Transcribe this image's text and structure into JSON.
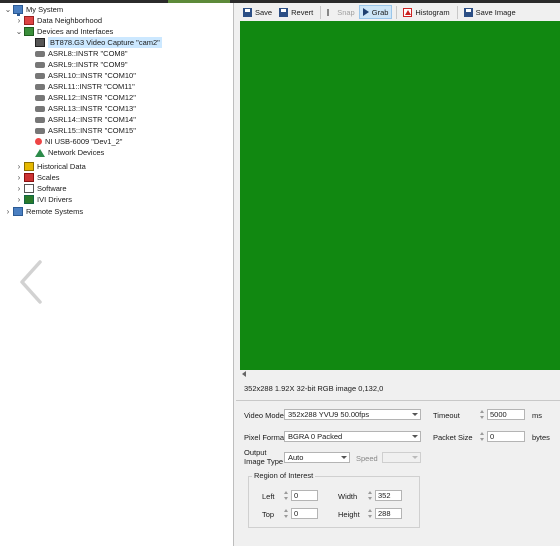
{
  "tree": {
    "items": [
      {
        "label": "My System",
        "icon": "computer-icon",
        "chevron": "v"
      },
      {
        "label": "Data Neighborhood",
        "icon": "data-neighborhood-icon",
        "chevron": ">"
      },
      {
        "label": "Devices and Interfaces",
        "icon": "devices-icon",
        "chevron": "v"
      },
      {
        "label": "BT878.G3 Video Capture  \"cam2\"",
        "icon": "camera-icon",
        "chevron": "",
        "selected": true
      },
      {
        "label": "ASRL8::INSTR \"COM8\"",
        "icon": "serial-port-icon",
        "chevron": ""
      },
      {
        "label": "ASRL9::INSTR \"COM9\"",
        "icon": "serial-port-icon",
        "chevron": ""
      },
      {
        "label": "ASRL10::INSTR \"COM10\"",
        "icon": "serial-port-icon",
        "chevron": ""
      },
      {
        "label": "ASRL11::INSTR \"COM11\"",
        "icon": "serial-port-icon",
        "chevron": ""
      },
      {
        "label": "ASRL12::INSTR \"COM12\"",
        "icon": "serial-port-icon",
        "chevron": ""
      },
      {
        "label": "ASRL13::INSTR \"COM13\"",
        "icon": "serial-port-icon",
        "chevron": ""
      },
      {
        "label": "ASRL14::INSTR \"COM14\"",
        "icon": "serial-port-icon",
        "chevron": ""
      },
      {
        "label": "ASRL15::INSTR \"COM15\"",
        "icon": "serial-port-icon",
        "chevron": ""
      },
      {
        "label": "NI USB-6009 \"Dev1_2\"",
        "icon": "usb-device-icon",
        "chevron": ""
      },
      {
        "label": "Network Devices",
        "icon": "network-devices-icon",
        "chevron": ""
      },
      {
        "label": "Historical Data",
        "icon": "historical-data-icon",
        "chevron": ">"
      },
      {
        "label": "Scales",
        "icon": "scales-icon",
        "chevron": ">"
      },
      {
        "label": "Software",
        "icon": "software-icon",
        "chevron": ">"
      },
      {
        "label": "IVI Drivers",
        "icon": "ivi-drivers-icon",
        "chevron": ">"
      },
      {
        "label": "Remote Systems",
        "icon": "remote-systems-icon",
        "chevron": ">"
      }
    ]
  },
  "toolbar": {
    "save": "Save",
    "revert": "Revert",
    "snap": "Snap",
    "grab": "Grab",
    "histogram": "Histogram",
    "save_image": "Save Image"
  },
  "image": {
    "color": "#118811",
    "status": "352x288  1.92X  32-bit RGB image  0,132,0"
  },
  "settings": {
    "video_mode_label": "Video Mode",
    "video_mode_value": "352x288 YVU9 50.00fps",
    "timeout_label": "Timeout",
    "timeout_value": "5000",
    "timeout_unit": "ms",
    "pixel_format_label": "Pixel Format",
    "pixel_format_value": "BGRA 0 Packed",
    "packet_size_label": "Packet Size",
    "packet_size_value": "0",
    "packet_size_unit": "bytes",
    "output_image_type_label_1": "Output",
    "output_image_type_label_2": "Image Type",
    "output_image_type_value": "Auto",
    "speed_label": "Speed",
    "speed_value": "",
    "roi_label": "Region of Interest",
    "left_label": "Left",
    "left_value": "0",
    "width_label": "Width",
    "width_value": "352",
    "top_label": "Top",
    "top_value": "0",
    "height_label": "Height",
    "height_value": "288"
  }
}
